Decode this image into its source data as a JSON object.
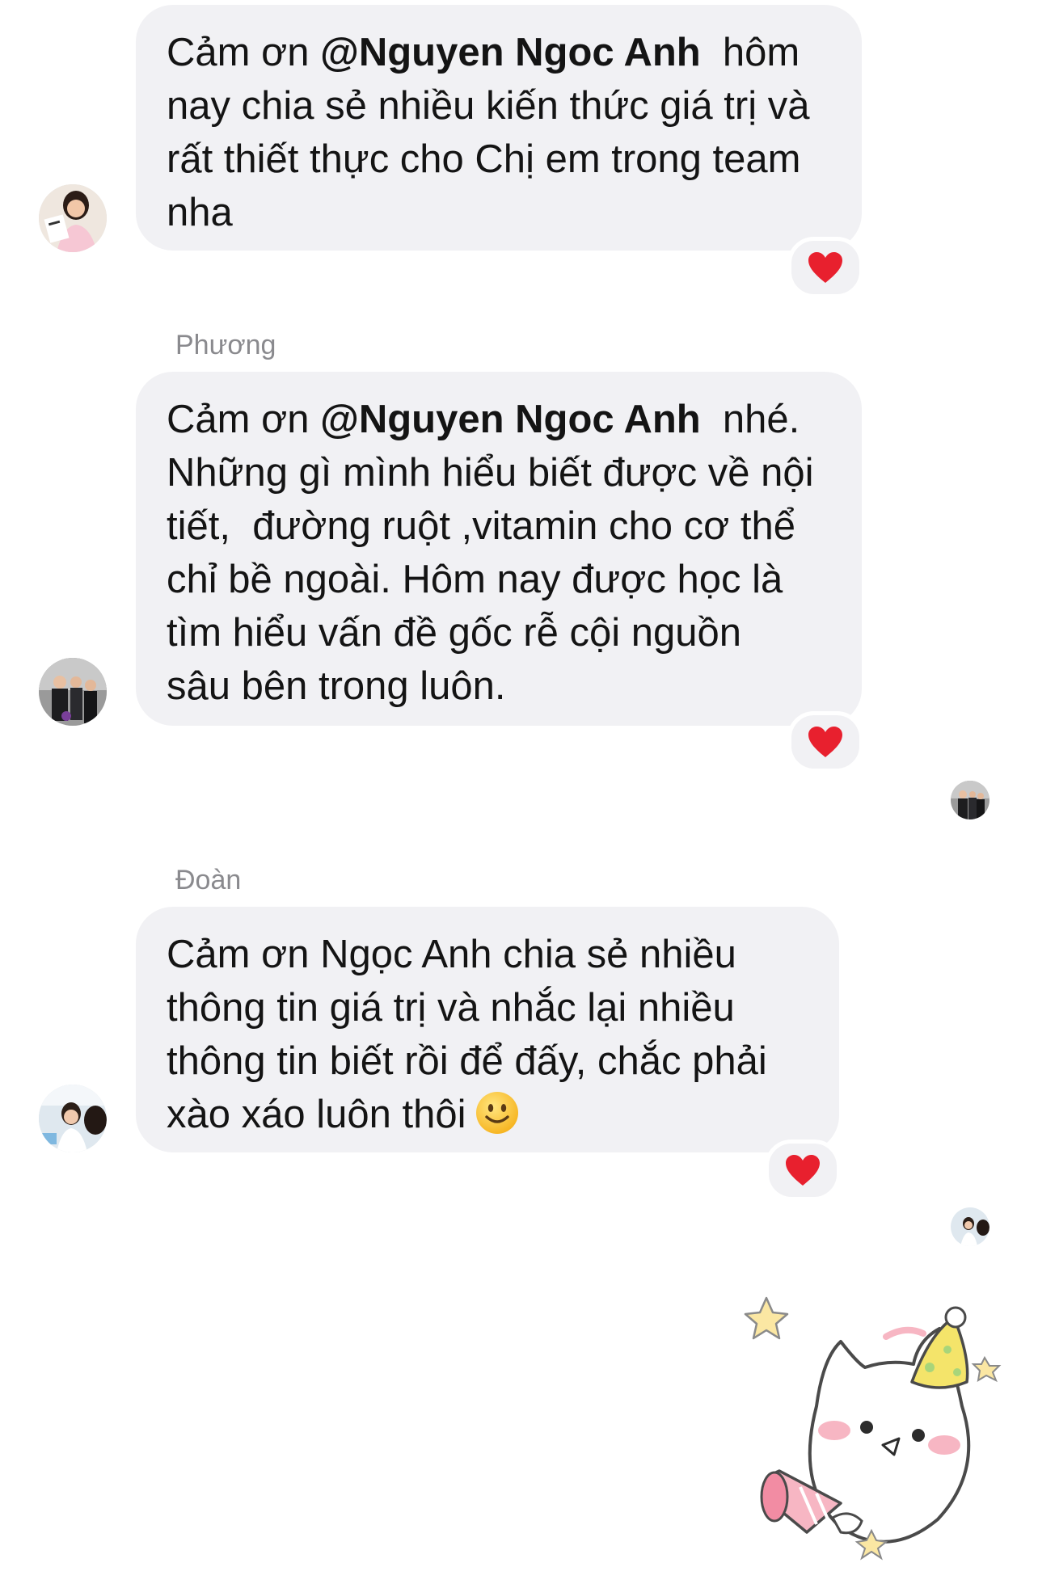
{
  "messages": [
    {
      "sender": "",
      "parts": [
        {
          "pre": "Cảm ơn ",
          "mention": "@Nguyen Ngoc Anh",
          "post": "  hôm"
        },
        {
          "text": "nay chia sẻ nhiều kiến thức giá trị và"
        },
        {
          "text": "rất thiết thực cho Chị em trong team"
        },
        {
          "text": "nha"
        }
      ],
      "reaction": "heart"
    },
    {
      "sender": "Phương",
      "parts": [
        {
          "pre": "Cảm ơn ",
          "mention": "@Nguyen Ngoc Anh",
          "post": "  nhé."
        },
        {
          "text": "Những gì mình hiểu biết được về nội"
        },
        {
          "text": "tiết,  đường ruột ,vitamin cho cơ thể"
        },
        {
          "text": "chỉ bề ngoài. Hôm nay được học là"
        },
        {
          "text": "tìm hiểu vấn đề gốc rễ cội nguồn"
        },
        {
          "text": "sâu bên trong luôn."
        }
      ],
      "reaction": "heart"
    },
    {
      "sender": "Đoàn",
      "parts": [
        {
          "text": "Cảm ơn Ngọc Anh chia sẻ nhiều"
        },
        {
          "text": "thông tin giá trị và nhắc lại nhiều"
        },
        {
          "text": "thông tin biết rồi để đấy, chắc phải"
        },
        {
          "text": "xào xáo luôn thôi",
          "emoji": "slightly-smiling-face"
        }
      ],
      "reaction": "heart"
    }
  ],
  "colors": {
    "bubble": "#f1f1f4",
    "sender_text": "#8a8a8e",
    "heart": "#e8202e"
  },
  "icons": {
    "reaction": "heart-icon",
    "sticker": "party-cat-sticker"
  }
}
